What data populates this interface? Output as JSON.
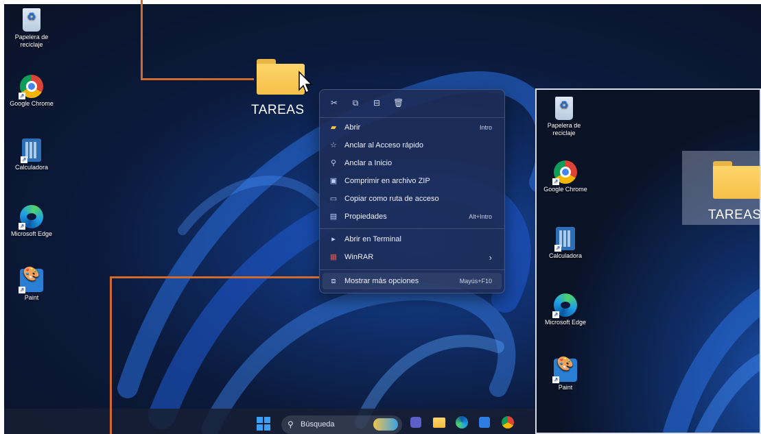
{
  "desktop_icons": [
    {
      "label": "Papelera de reciclaje",
      "icon": "recycle-bin-icon"
    },
    {
      "label": "Google Chrome",
      "icon": "chrome-icon"
    },
    {
      "label": "Calculadora",
      "icon": "calculator-icon"
    },
    {
      "label": "Microsoft Edge",
      "icon": "edge-icon"
    },
    {
      "label": "Paint",
      "icon": "paint-icon"
    }
  ],
  "folder": {
    "label": "TAREAS",
    "icon": "folder-icon"
  },
  "context_menu": {
    "top_actions": [
      {
        "name": "cut",
        "icon": "cut-icon",
        "glyph": "✂"
      },
      {
        "name": "copy",
        "icon": "copy-icon",
        "glyph": "⧉"
      },
      {
        "name": "rename",
        "icon": "rename-icon",
        "glyph": "⊟"
      },
      {
        "name": "delete",
        "icon": "delete-icon",
        "glyph": "🗑"
      }
    ],
    "items": [
      {
        "label": "Abrir",
        "shortcut": "Intro",
        "icon": "folder-open-icon",
        "glyph": "▰"
      },
      {
        "label": "Anclar al Acceso rápido",
        "shortcut": "",
        "icon": "star-icon",
        "glyph": "☆"
      },
      {
        "label": "Anclar a Inicio",
        "shortcut": "",
        "icon": "pin-icon",
        "glyph": "⚲"
      },
      {
        "label": "Comprimir en archivo ZIP",
        "shortcut": "",
        "icon": "zip-icon",
        "glyph": "▣"
      },
      {
        "label": "Copiar como ruta de acceso",
        "shortcut": "",
        "icon": "path-icon",
        "glyph": "▭"
      },
      {
        "label": "Propiedades",
        "shortcut": "Alt+Intro",
        "icon": "properties-icon",
        "glyph": "▤"
      },
      {
        "label": "Abrir en Terminal",
        "shortcut": "",
        "icon": "terminal-icon",
        "glyph": "▸"
      },
      {
        "label": "WinRAR",
        "shortcut": "›",
        "icon": "winrar-icon",
        "glyph": "▦"
      },
      {
        "label": "Mostrar más opciones",
        "shortcut": "Mayús+F10",
        "icon": "more-options-icon",
        "glyph": "⧈"
      }
    ]
  },
  "taskbar": {
    "search_placeholder": "Búsqueda",
    "apps": [
      "start-icon",
      "search-icon",
      "widgets-icon",
      "teams-icon",
      "file-explorer-icon",
      "edge-icon",
      "store-icon",
      "chrome-icon"
    ]
  },
  "inset": {
    "icons": [
      {
        "label": "Papelera de reciclaje",
        "icon": "recycle-bin-icon"
      },
      {
        "label": "Google Chrome",
        "icon": "chrome-icon"
      },
      {
        "label": "Calculadora",
        "icon": "calculator-icon"
      },
      {
        "label": "Microsoft Edge",
        "icon": "edge-icon"
      },
      {
        "label": "Paint",
        "icon": "paint-icon"
      }
    ],
    "folder_label": "TAREAS"
  },
  "colors": {
    "callout": "#d26a2c",
    "accent": "#3ba0f5"
  }
}
